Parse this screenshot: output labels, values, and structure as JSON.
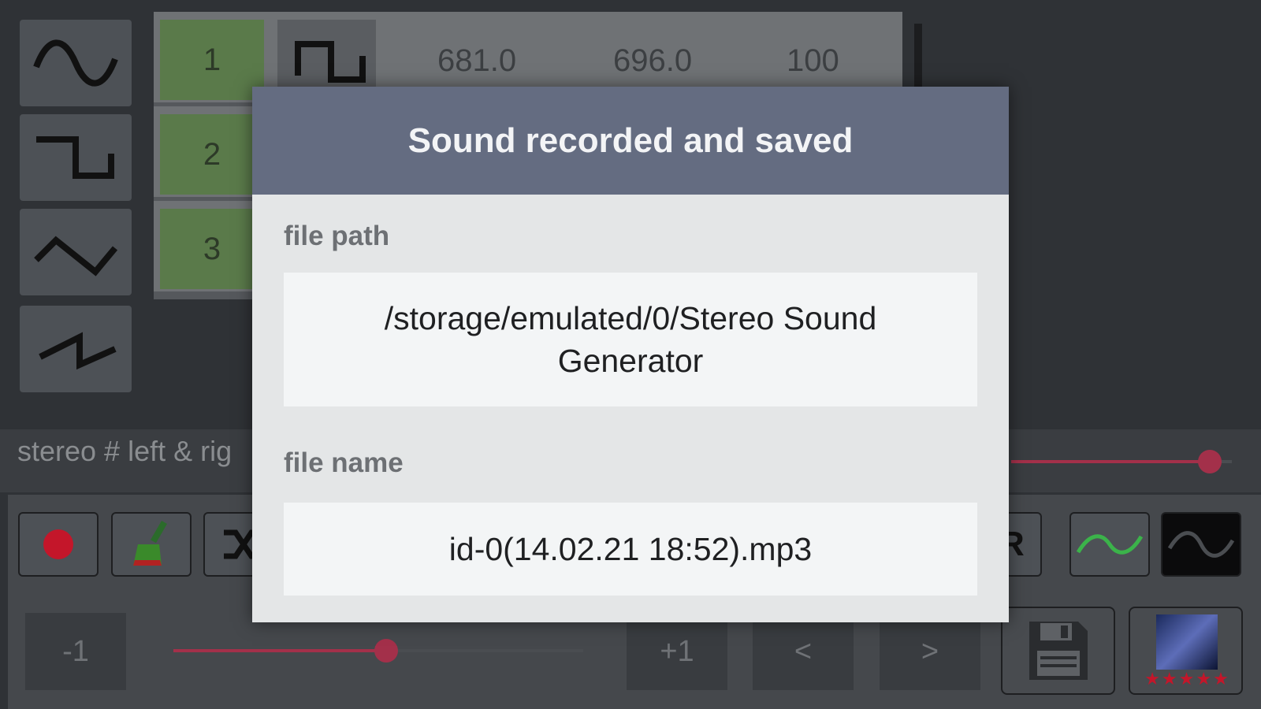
{
  "table": {
    "rows": [
      {
        "num": "1",
        "v1": "681.0",
        "v2": "696.0",
        "v3": "100"
      },
      {
        "num": "2"
      },
      {
        "num": "3"
      }
    ]
  },
  "stereo": {
    "label": "stereo # left & rig",
    "balance_level": 0.9
  },
  "toolbar": {
    "equal_label": "=R"
  },
  "controls": {
    "minus_label": "-1",
    "plus_label": "+1",
    "prev_label": "<",
    "next_label": ">",
    "slider_level": 0.52
  },
  "rating": {
    "stars": "★★★★★"
  },
  "dialog": {
    "title": "Sound recorded and saved",
    "path_label": "file path",
    "path_value": "/storage/emulated/0/Stereo Sound Generator",
    "name_label": "file name",
    "name_value": "id-0(14.02.21 18:52).mp3"
  },
  "colors": {
    "accent": "#a3304a",
    "dialog_header": "#646c81",
    "row_number_bg": "#5a7a4a"
  }
}
